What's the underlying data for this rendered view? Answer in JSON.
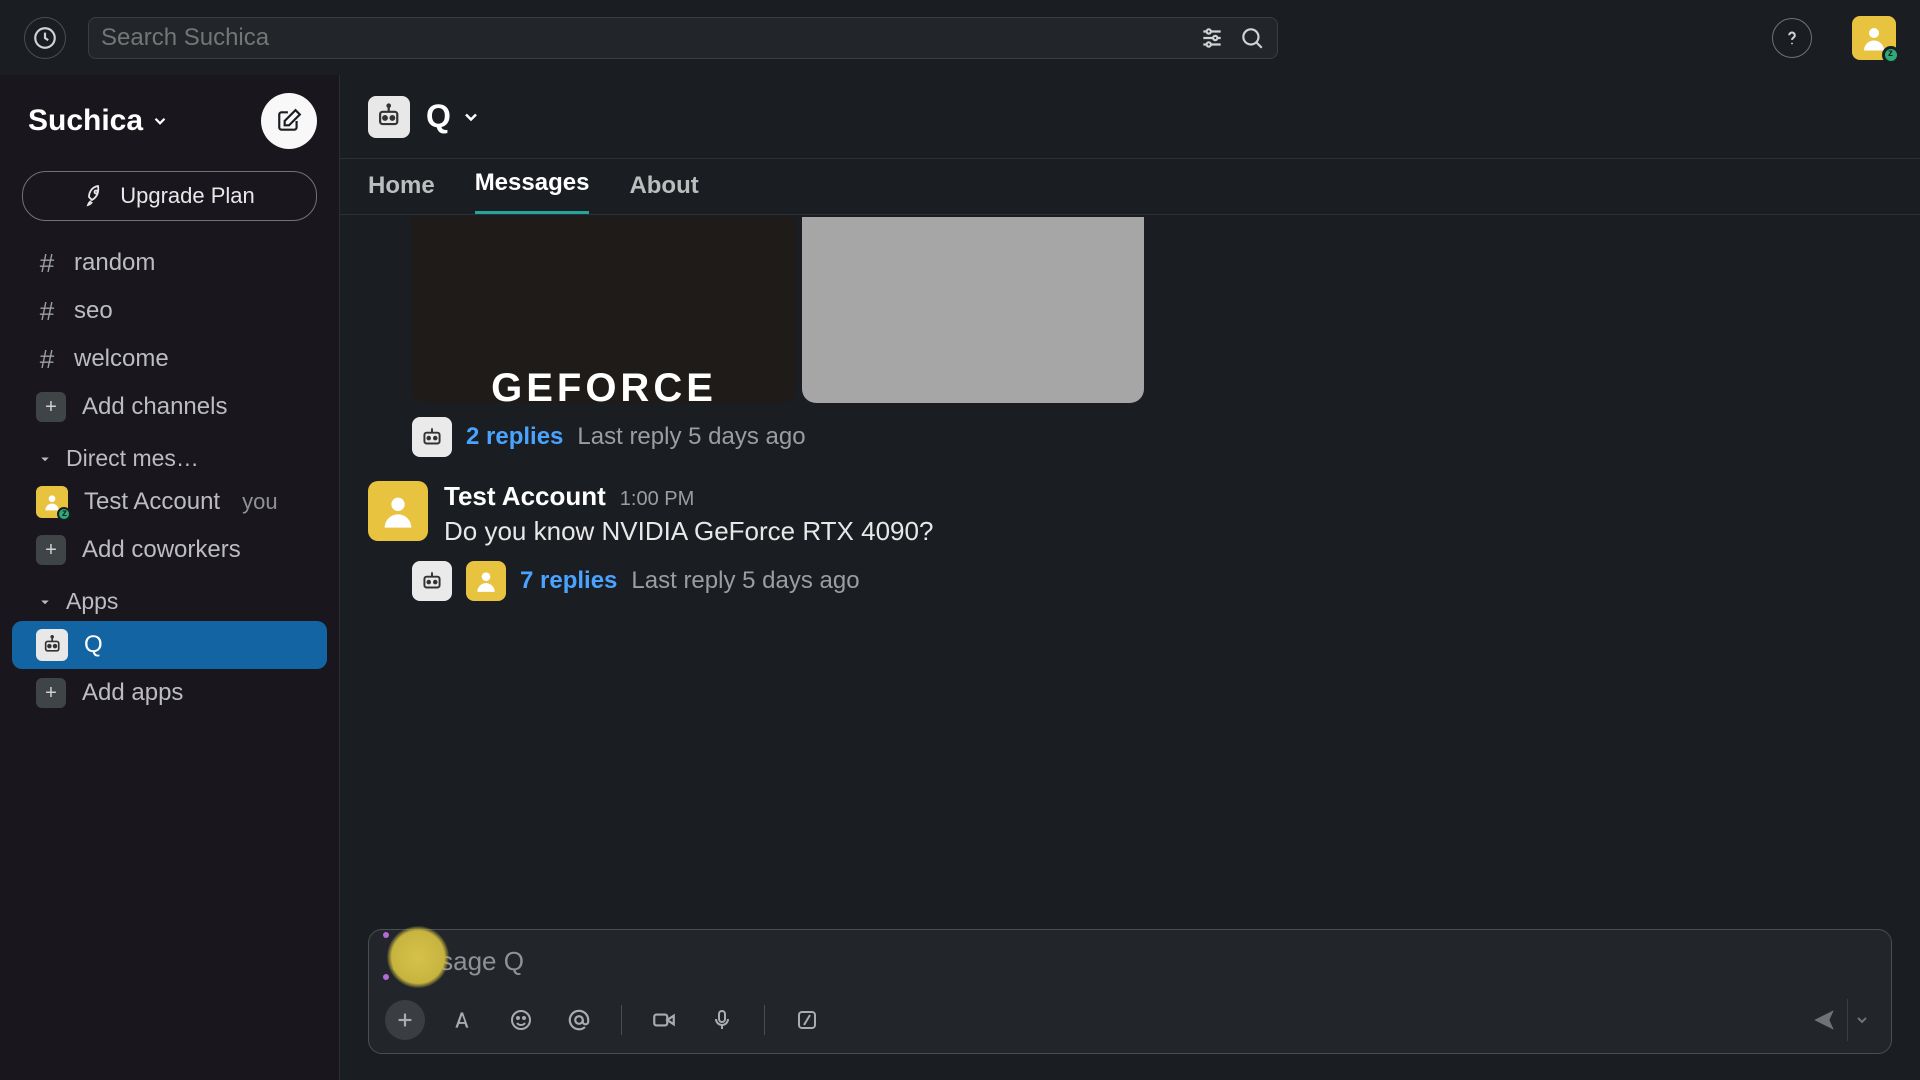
{
  "topbar": {
    "search_placeholder": "Search Suchica"
  },
  "workspace": {
    "name": "Suchica",
    "upgrade_label": "Upgrade Plan"
  },
  "sidebar": {
    "channels": [
      {
        "name": "random"
      },
      {
        "name": "seo"
      },
      {
        "name": "welcome"
      }
    ],
    "add_channels_label": "Add channels",
    "dm_section_label": "Direct mes…",
    "dm_user": "Test Account",
    "dm_you": "you",
    "add_coworkers_label": "Add coworkers",
    "apps_section_label": "Apps",
    "apps": [
      {
        "name": "Q"
      }
    ],
    "add_apps_label": "Add apps"
  },
  "header": {
    "app_name": "Q"
  },
  "tabs": {
    "home": "Home",
    "messages": "Messages",
    "about": "About"
  },
  "media": {
    "geforce_text": "GEFORCE"
  },
  "thread1": {
    "replies": "2 replies",
    "meta": "Last reply 5 days ago"
  },
  "message": {
    "author": "Test Account",
    "time": "1:00 PM",
    "text": "Do you know NVIDIA GeForce RTX 4090?"
  },
  "thread2": {
    "replies": "7 replies",
    "meta": "Last reply 5 days ago"
  },
  "composer": {
    "placeholder": "Message Q"
  }
}
